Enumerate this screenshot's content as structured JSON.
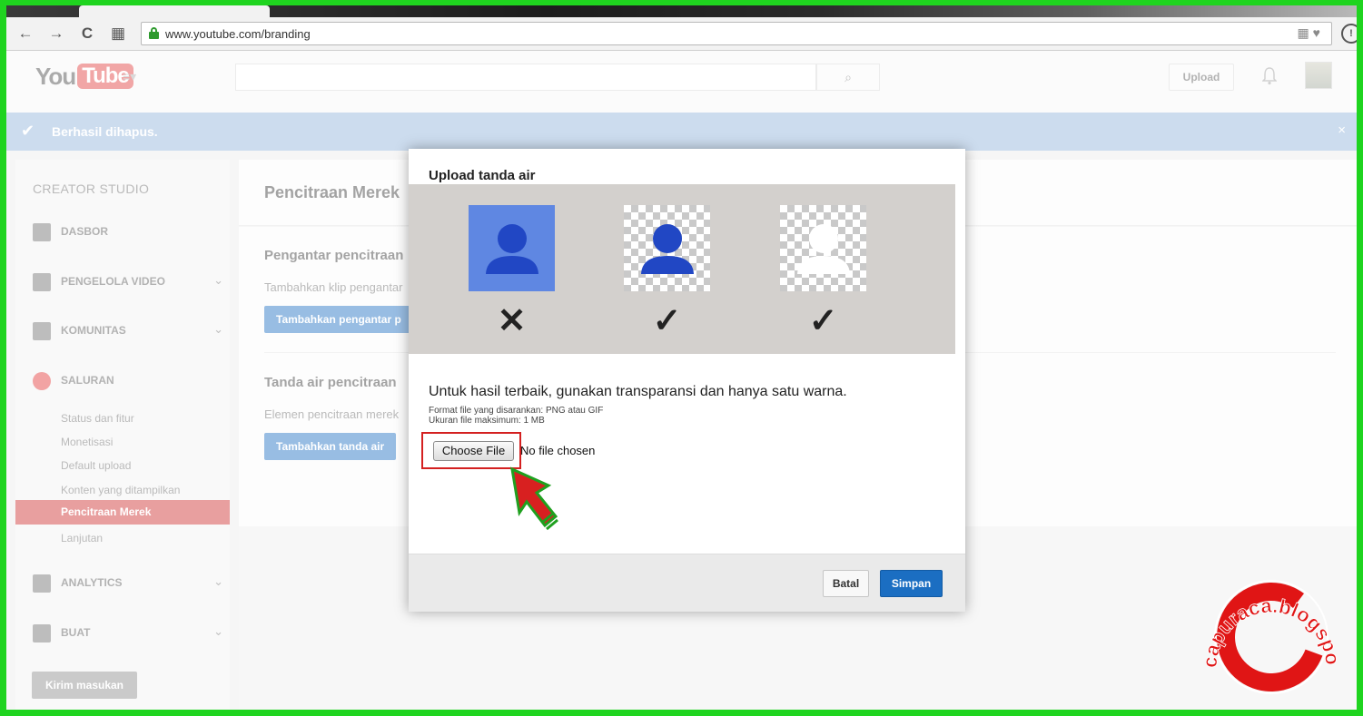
{
  "browser": {
    "url": "www.youtube.com/branding",
    "back_icon": "←",
    "forward_icon": "→",
    "reload_icon": "C",
    "apps_icon": "▦",
    "omnibox_icons": "▦♥",
    "extension_icon": "!"
  },
  "header": {
    "logo_you": "You",
    "logo_tube": "Tube",
    "guide_icon": "≡▾",
    "search_icon": "⌕",
    "upload_label": "Upload",
    "bell_icon": "♫"
  },
  "notification": {
    "check_icon": "✔",
    "message": "Berhasil dihapus.",
    "close_icon": "×"
  },
  "sidebar": {
    "title": "CREATOR STUDIO",
    "items": [
      {
        "label": "DASBOR"
      },
      {
        "label": "PENGELOLA VIDEO",
        "chevron": "⌄"
      },
      {
        "label": "KOMUNITAS",
        "chevron": "⌄"
      },
      {
        "label": "SALURAN"
      },
      {
        "label": "ANALYTICS",
        "chevron": "⌄"
      },
      {
        "label": "BUAT",
        "chevron": "⌄"
      }
    ],
    "sub_items": [
      "Status dan fitur",
      "Monetisasi",
      "Default upload",
      "Konten yang ditampilkan",
      "Pencitraan Merek",
      "Lanjutan"
    ],
    "feedback_label": "Kirim masukan"
  },
  "main": {
    "page_title": "Pencitraan Merek",
    "sections": [
      {
        "heading": "Pengantar pencitraan",
        "text": "Tambahkan klip pengantar",
        "button": "Tambahkan pengantar p"
      },
      {
        "heading": "Tanda air pencitraan",
        "text": "Elemen pencitraan merek",
        "button": "Tambahkan tanda air"
      }
    ]
  },
  "modal": {
    "title": "Upload tanda air",
    "examples": [
      {
        "style": "solid",
        "verdict": "✕"
      },
      {
        "style": "transparent-blue",
        "verdict": "✓"
      },
      {
        "style": "transparent-white",
        "verdict": "✓"
      }
    ],
    "tip": "Untuk hasil terbaik, gunakan transparansi dan hanya satu warna.",
    "format_line": "Format file yang disarankan: PNG atau GIF",
    "size_line": "Ukuran file maksimum: 1 MB",
    "choose_file_label": "Choose File",
    "no_file_label": "No file chosen",
    "cancel_label": "Batal",
    "save_label": "Simpan"
  },
  "watermark": {
    "text": "capuraca.blogspot.com"
  },
  "colors": {
    "border_green": "#1fd41f",
    "brand_red": "#e03a3a",
    "primary_blue": "#1b6ec2",
    "notice_blue": "#8fb2da",
    "highlight_red": "#d42020"
  }
}
